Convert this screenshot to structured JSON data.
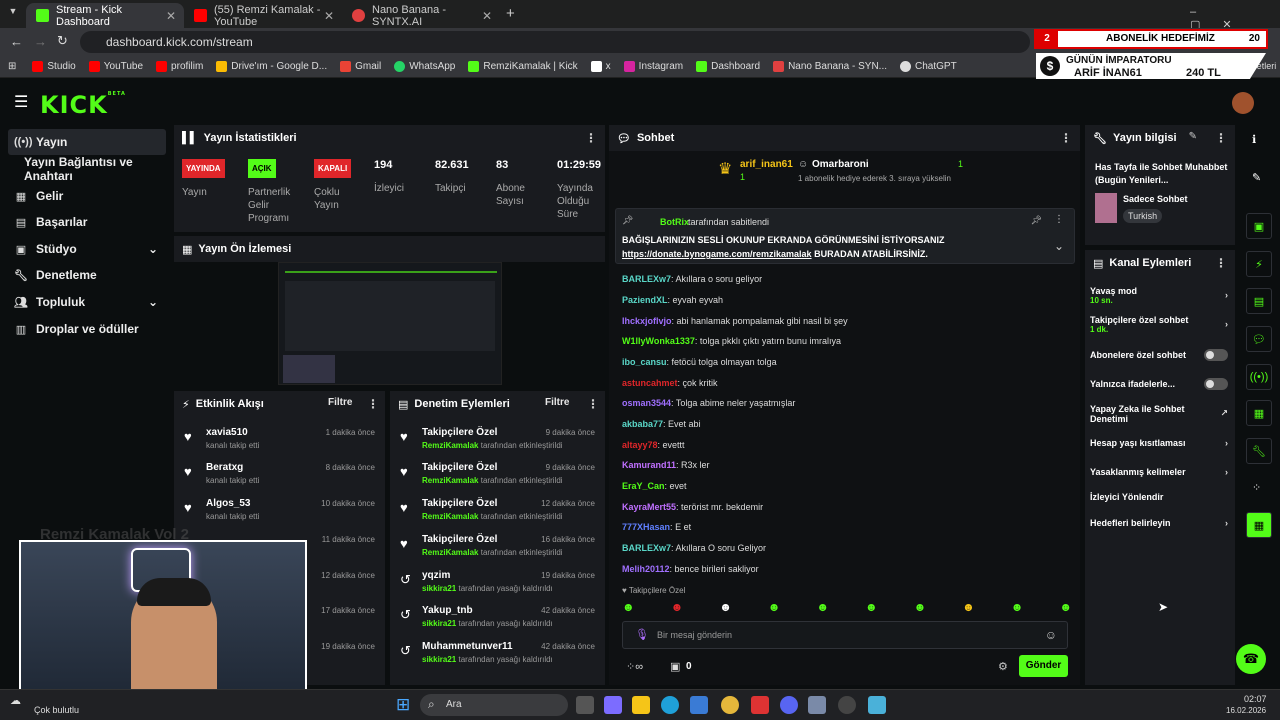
{
  "browser": {
    "tabs": [
      {
        "title": "Stream - Kick Dashboard",
        "color": "#53fc18",
        "active": true
      },
      {
        "title": "(55) Remzi Kamalak - YouTube",
        "color": "#ff0000",
        "active": false
      },
      {
        "title": "Nano Banana - SYNTX.AI",
        "color": "#e04040",
        "active": false
      }
    ],
    "url": "dashboard.kick.com/stream",
    "bookmarks": [
      "Studio",
      "YouTube",
      "profilim",
      "Drive'ım - Google D...",
      "Gmail",
      "WhatsApp",
      "RemziKamalak | Kick",
      "x",
      "Instagram",
      "Dashboard",
      "Nano Banana - SYN...",
      "ChatGPT"
    ],
    "bookmarks_right": "Yer İşaretleri"
  },
  "overlay": {
    "sub_goal_num": "2",
    "sub_goal_label": "ABONELİK HEDEFİMİZ",
    "sub_goal_target": "20",
    "emperor_title": "GÜNÜN İMPARATORU",
    "emperor_name": "ARİF İNAN61",
    "emperor_amount": "240 TL",
    "webcam_channel": "Remzi Kamalak Vol 2"
  },
  "brand": {
    "logo": "KICK",
    "beta": "BETA"
  },
  "sidebar": {
    "items": [
      {
        "label": "Yayın",
        "icon": "stream-icon"
      },
      {
        "label": "Yayın Bağlantısı ve Anahtarı",
        "icon": ""
      },
      {
        "label": "Gelir",
        "icon": "revenue-icon"
      },
      {
        "label": "Başarılar",
        "icon": "achievements-icon"
      },
      {
        "label": "Stüdyo",
        "icon": "studio-icon"
      },
      {
        "label": "Denetleme",
        "icon": "wrench-icon"
      },
      {
        "label": "Topluluk",
        "icon": "community-icon"
      },
      {
        "label": "Droplar ve ödüller",
        "icon": "drops-icon"
      }
    ]
  },
  "stats": {
    "title": "Yayın İstatistikleri",
    "items": [
      {
        "badge": "YAYINDA",
        "label": "Yayın",
        "color": "#e0262a"
      },
      {
        "badge": "AÇIK",
        "label": "Partnerlik Gelir Programı",
        "color": "#53fc18"
      },
      {
        "badge": "KAPALI",
        "label": "Çoklu Yayın",
        "color": "#e0262a"
      },
      {
        "value": "194",
        "label": "İzleyici"
      },
      {
        "value": "82.631",
        "label": "Takipçi"
      },
      {
        "value": "83",
        "label": "Abone Sayısı"
      },
      {
        "value": "01:29:59",
        "label": "Yayında Olduğu Süre"
      }
    ]
  },
  "preview": {
    "title": "Yayın Ön İzlemesi"
  },
  "activity": {
    "title": "Etkinlik Akışı",
    "filter": "Filtre",
    "rows": [
      {
        "name": "xavia510",
        "desc": "kanalı takip etti",
        "time": "1 dakika önce"
      },
      {
        "name": "Beratxg",
        "desc": "kanalı takip etti",
        "time": "8 dakika önce"
      },
      {
        "name": "Algos_53",
        "desc": "kanalı takip etti",
        "time": "10 dakika önce"
      },
      {
        "name": "",
        "desc": "",
        "time": "11 dakika önce"
      },
      {
        "name": "",
        "desc": "",
        "time": "12 dakika önce"
      },
      {
        "name": "",
        "desc": "",
        "time": "17 dakika önce"
      },
      {
        "name": "",
        "desc": "",
        "time": "19 dakika önce"
      }
    ]
  },
  "moderation": {
    "title": "Denetim Eylemleri",
    "filter": "Filtre",
    "rows": [
      {
        "name": "Takipçilere Özel",
        "by": "RemziKamalak",
        "desc": "tarafından etkinleştirildi",
        "time": "9 dakika önce"
      },
      {
        "name": "Takipçilere Özel",
        "by": "RemziKamalak",
        "desc": "tarafından etkinleştirildi",
        "time": "9 dakika önce"
      },
      {
        "name": "Takipçilere Özel",
        "by": "RemziKamalak",
        "desc": "tarafından etkinleştirildi",
        "time": "12 dakika önce"
      },
      {
        "name": "Takipçilere Özel",
        "by": "RemziKamalak",
        "desc": "tarafından etkinleştirildi",
        "time": "16 dakika önce"
      },
      {
        "name": "yqzim",
        "by": "sikkira21",
        "desc": "tarafından yasağı kaldırıldı",
        "time": "19 dakika önce"
      },
      {
        "name": "Yakup_tnb",
        "by": "sikkira21",
        "desc": "tarafından yasağı kaldırıldı",
        "time": "42 dakika önce"
      },
      {
        "name": "Muhammetunver11",
        "by": "sikkira21",
        "desc": "tarafından yasağı kaldırıldı",
        "time": "42 dakika önce"
      }
    ]
  },
  "chat": {
    "title": "Sohbet",
    "gift_user": "arif_inan61",
    "gift_target": "Omarbaroni",
    "gift_count": "1",
    "gift_count2": "1",
    "gift_desc": "1 abonelik hediye ederek 3. sıraya yükselin",
    "pinned_by": "BotRix",
    "pinned_label": "tarafından sabitlendi",
    "pinned_text": "BAĞIŞLARINIZIN SESLİ OKUNUP EKRANDA GÖRÜNMESİNİ İSTİYORSANIZ",
    "pinned_link": "https://donate.bynogame.com/remzikamalak",
    "pinned_text2": "BURADAN ATABİLİRSİNİZ.",
    "messages": [
      {
        "user": "BARLEXw7",
        "text": "Akıllara o soru geliyor",
        "color": "#5ad7c8"
      },
      {
        "user": "PaziendXL",
        "text": "eyvah eyvah",
        "color": "#5ad7c8"
      },
      {
        "user": "Ihckxjoflvjo",
        "text": "abi hanlamak pompalamak gibi nasil bi şey",
        "color": "#a070ff"
      },
      {
        "user": "W1llyWonka1337",
        "text": "tolga pkklı çıktı yatırn bunu imralıya",
        "color": "#53fc18"
      },
      {
        "user": "ibo_cansu",
        "text": "fetöcü tolga olmayan tolga",
        "color": "#5ad7c8"
      },
      {
        "user": "astuncahmet",
        "text": "çok kritik",
        "color": "#e0262a"
      },
      {
        "user": "osman3544",
        "text": "Tolga abime neler yaşatmışlar",
        "color": "#a070ff"
      },
      {
        "user": "akbaba77",
        "text": "Evet abi",
        "color": "#5ad7c8"
      },
      {
        "user": "altayy78",
        "text": "evettt",
        "color": "#e0262a"
      },
      {
        "user": "Kamurand11",
        "text": "R3x ler",
        "color": "#c070ff"
      },
      {
        "user": "EraY_Can",
        "text": "evet",
        "color": "#53fc18"
      },
      {
        "user": "KayraMert55",
        "text": "terörist mr. bekdemir",
        "color": "#c070ff"
      },
      {
        "user": "777XHasan",
        "text": "E et",
        "color": "#6080ff"
      },
      {
        "user": "BARLEXw7",
        "text": "Akıllara O soru Geliyor",
        "color": "#5ad7c8"
      },
      {
        "user": "Melih20112",
        "text": "bence birileri sakliyor",
        "color": "#a070ff"
      }
    ],
    "followers_only": "Takipçilere Özel",
    "input_placeholder": "Bir mesaj gönderin",
    "count": "0",
    "send": "Gönder"
  },
  "stream_info": {
    "title": "Yayın bilgisi",
    "stream_title": "Has Tayfa ile Sohbet Muhabbet (Bugün Yenileri...",
    "category": "Sadece Sohbet",
    "language": "Turkish"
  },
  "channel_actions": {
    "title": "Kanal Eylemleri",
    "items": [
      {
        "label": "Yavaş mod",
        "sub": "10 sn.",
        "type": "chevron"
      },
      {
        "label": "Takipçilere özel sohbet",
        "sub": "1 dk.",
        "type": "chevron"
      },
      {
        "label": "Abonelere özel sohbet",
        "sub": "",
        "type": "toggle"
      },
      {
        "label": "Yalnızca ifadelerle...",
        "sub": "",
        "type": "toggle"
      },
      {
        "label": "Yapay Zeka ile Sohbet Denetimi",
        "sub": "",
        "type": "external"
      },
      {
        "label": "Hesap yaşı kısıtlaması",
        "sub": "",
        "type": "chevron"
      },
      {
        "label": "Yasaklanmış kelimeler",
        "sub": "",
        "type": "chevron"
      },
      {
        "label": "İzleyici Yönlendir",
        "sub": "",
        "type": "none"
      },
      {
        "label": "Hedefleri belirleyin",
        "sub": "",
        "type": "chevron"
      }
    ]
  },
  "taskbar": {
    "weather": "Çok bulutlu",
    "search": "Ara",
    "time": "02:07",
    "date": "16.02.2026"
  }
}
